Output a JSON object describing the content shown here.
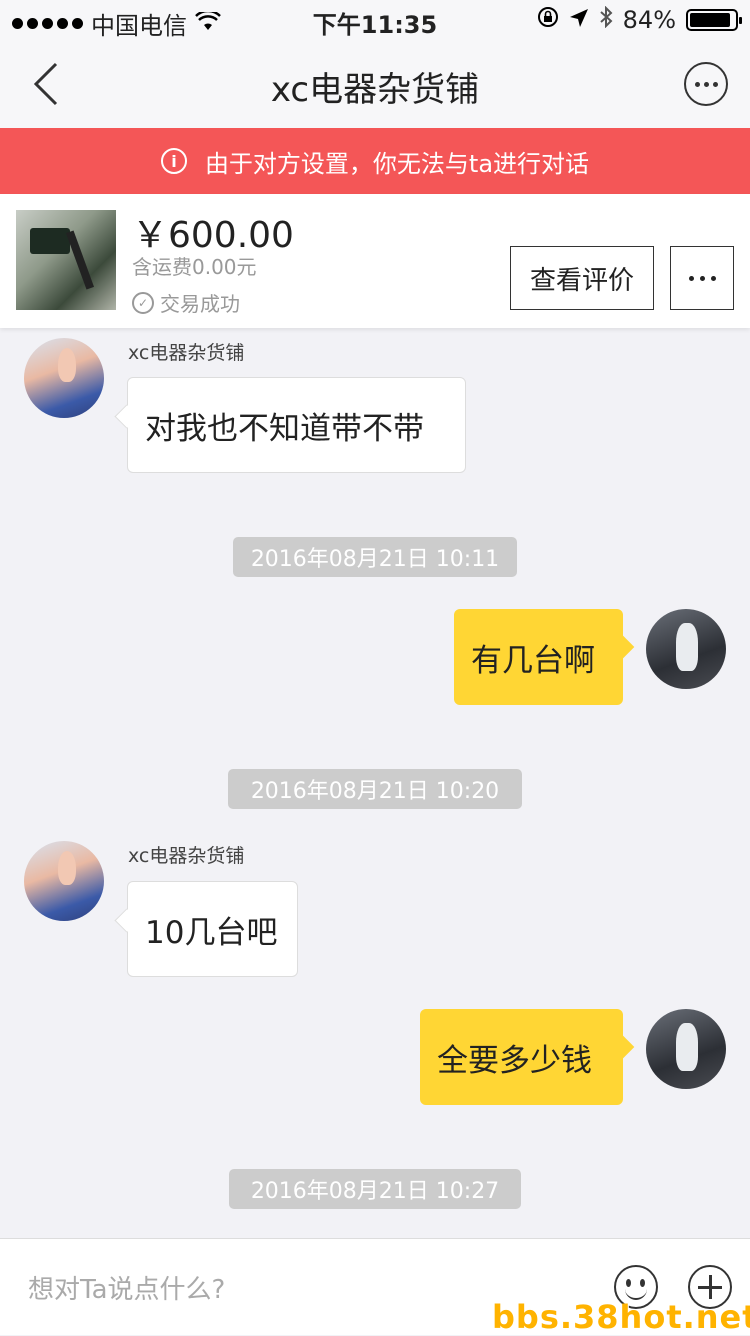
{
  "status_bar": {
    "carrier": "中国电信",
    "time": "下午11:35",
    "battery": "84%",
    "battery_level": 0.84
  },
  "nav": {
    "title": "xc电器杂货铺",
    "back_icon": "chevron-left-icon",
    "more_icon": "more-circle-icon"
  },
  "alert": {
    "text": "由于对方设置，你无法与ta进行对话",
    "color": "#f45657"
  },
  "product": {
    "price": "￥600.00",
    "shipping": "含运费0.00元",
    "status": "交易成功",
    "review_label": "查看评价"
  },
  "messages": [
    {
      "sender": "xc电器杂货铺",
      "text": "对我也不知道带不带"
    },
    {
      "timestamp": "2016年08月21日 10:11"
    },
    {
      "text": "有几台啊"
    },
    {
      "timestamp": "2016年08月21日 10:20"
    },
    {
      "sender": "xc电器杂货铺",
      "text": "10几台吧"
    },
    {
      "text": "全要多少钱"
    },
    {
      "timestamp": "2016年08月21日 10:27"
    }
  ],
  "input": {
    "placeholder": "想对Ta说点什么?"
  },
  "watermark": "bbs.38hot.net",
  "colors": {
    "outgoing_bubble": "#ffd634",
    "incoming_bubble": "#ffffff"
  }
}
